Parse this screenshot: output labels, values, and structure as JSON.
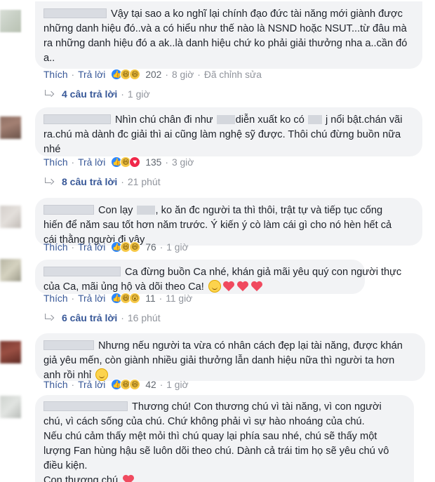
{
  "comments": [
    {
      "text_before": "Vậy tại sao a ko nghĩ lại chính đạo đức tài năng mới giành được những danh hiệu đó..và a có hiểu như thế nào là NSND hoặc NSUT...từ đâu mà ra những danh hiệu đó a ak..là danh hiệu chứ ko phải giải thưởng nha a..cần đó a..",
      "actions": {
        "like": "Thích",
        "reply": "Trả lời",
        "count": "202",
        "time": "8 giờ",
        "edited": "Đã chỉnh sửa"
      },
      "reactions": [
        "like",
        "haha",
        "haha"
      ],
      "replies": {
        "label": "4 câu trả lời",
        "time": "1 giờ"
      }
    },
    {
      "line1a": "Nhìn chú chân đi như",
      "line1b": "diễn xuất ko có",
      "line1c": "j nổi bật.chán vãi",
      "line2": "ra.chú mà dành đc giải thì ai cũng làm nghệ sỹ được. Thôi chú đừng buồn nữa",
      "line3": "nhé",
      "actions": {
        "like": "Thích",
        "reply": "Trả lời",
        "count": "135",
        "time": "3 giờ"
      },
      "reactions": [
        "like",
        "haha",
        "love"
      ],
      "replies": {
        "label": "8 câu trả lời",
        "time": "21 phút"
      }
    },
    {
      "line1a": "Con lạy",
      "line1b": ", ko ăn đc người ta thì thôi, trật tự và tiếp tục cống",
      "line2": "hiến để năm sau tốt hơn năm trước. Ý kiến ý cò làm cái gì cho nó hèn hết cả",
      "line3": "cái thằng người đi vậy",
      "actions": {
        "like": "Thích",
        "reply": "Trả lời",
        "count": "76",
        "time": "1 giờ"
      },
      "reactions": [
        "like",
        "haha",
        "haha"
      ]
    },
    {
      "line1": "Ca đừng buồn Ca nhé, khán giả mãi yêu quý con người thực",
      "line2": "của Ca, mãi ủng hộ và dõi theo Ca!",
      "actions": {
        "like": "Thích",
        "reply": "Trả lời",
        "count": "11",
        "time": "11 giờ"
      },
      "reactions": [
        "like",
        "haha",
        "wow"
      ],
      "replies": {
        "label": "6 câu trả lời",
        "time": "16 phút"
      }
    },
    {
      "line1": "Nhưng nếu người ta vừa có nhân cách đẹp lại tài năng, được khán",
      "line2": "giả yêu mến, còn giành nhiều giải thưởng lẫn danh hiệu nữa thì người ta hơn",
      "line3": "anh rồi nhỉ",
      "actions": {
        "like": "Thích",
        "reply": "Trả lời",
        "count": "42",
        "time": "1 giờ"
      },
      "reactions": [
        "like",
        "haha",
        "haha"
      ]
    },
    {
      "line1": "Thương chú! Con thương chú vì tài năng, vì con người",
      "line2": "chú, vì cách sống của chú. Chứ không phải vì sự hào nhoáng của chú.",
      "line3": "Nếu chú cảm thấy mệt mỏi thì chú quay lại phía sau nhé, chú sẽ thấy một",
      "line4": "lượng Fan hùng hậu sẽ luôn dõi theo chú. Dành cả trái tim họ sẽ yêu chú vô",
      "line5": "điều kiện.",
      "line6": "Con thương chú"
    }
  ],
  "colors": {
    "link": "#385898",
    "meta": "#90949c",
    "bubble": "#f2f3f5"
  }
}
